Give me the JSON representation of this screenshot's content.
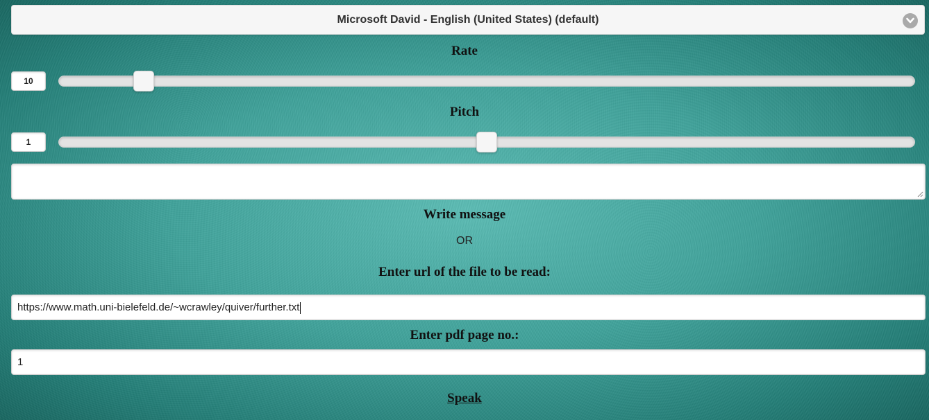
{
  "voice": {
    "selected": "Microsoft David - English (United States) (default)"
  },
  "rate": {
    "label": "Rate",
    "value": "10",
    "slider_fraction": 0.09
  },
  "pitch": {
    "label": "Pitch",
    "value": "1",
    "slider_fraction": 0.5
  },
  "message": {
    "value": "",
    "label": "Write message"
  },
  "or_text": "OR",
  "url": {
    "label": "Enter url of the file to be read:",
    "value": "https://www.math.uni-bielefeld.de/~wcrawley/quiver/further.txt"
  },
  "pdf_page": {
    "label": "Enter pdf page no.:",
    "value": "1"
  },
  "speak_label": "Speak",
  "icons": {
    "dropdown": "chevron-down-icon",
    "resize": "resize-grip-icon"
  },
  "colors": {
    "background": "#3fa39b",
    "panel": "#f6f6f6"
  }
}
